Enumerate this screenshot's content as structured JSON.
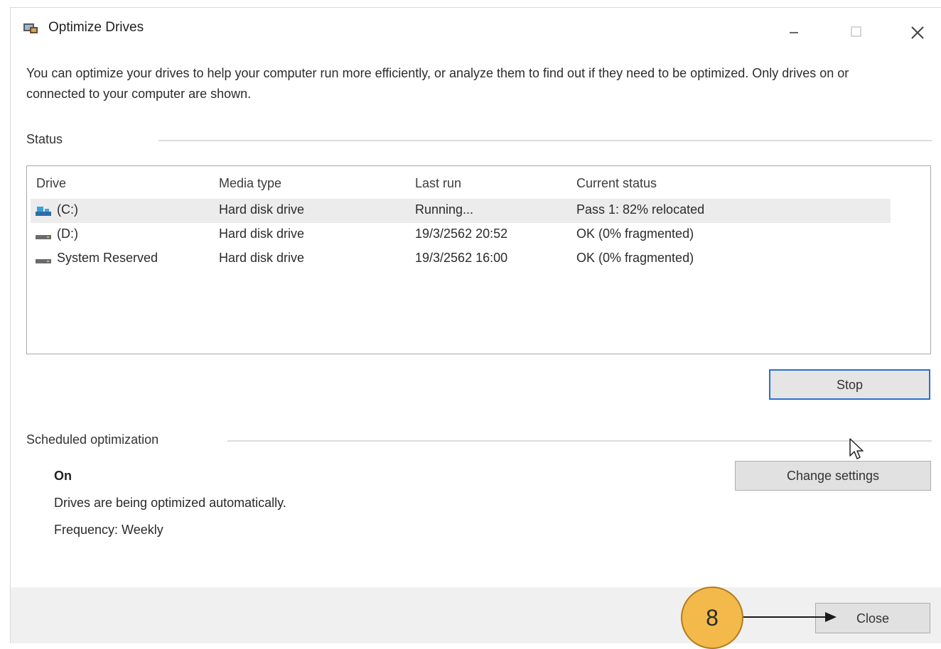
{
  "window": {
    "title": "Optimize Drives",
    "app_icon": "optimize-drives-icon",
    "controls": [
      "minimize-icon",
      "maximize-icon",
      "close-icon"
    ]
  },
  "description": "You can optimize your drives to help your computer run more efficiently, or analyze them to find out if they need to be optimized. Only drives on or connected to your computer are shown.",
  "status": {
    "label": "Status",
    "columns": [
      "Drive",
      "Media type",
      "Last run",
      "Current status"
    ],
    "rows": [
      {
        "drive": "(C:)",
        "icon": "system-drive-icon",
        "media_type": "Hard disk drive",
        "last_run": "Running...",
        "current_status": "Pass 1: 82% relocated",
        "selected": true
      },
      {
        "drive": "(D:)",
        "icon": "hard-drive-icon",
        "media_type": "Hard disk drive",
        "last_run": "19/3/2562 20:52",
        "current_status": "OK (0% fragmented)",
        "selected": false
      },
      {
        "drive": "System Reserved",
        "icon": "hard-drive-icon",
        "media_type": "Hard disk drive",
        "last_run": "19/3/2562 16:00",
        "current_status": "OK (0% fragmented)",
        "selected": false
      }
    ],
    "stop_button": "Stop"
  },
  "scheduled": {
    "label": "Scheduled optimization",
    "state": "On",
    "line1": "Drives are being optimized automatically.",
    "line2": "Frequency: Weekly",
    "change_button": "Change settings"
  },
  "footer": {
    "close_button": "Close"
  },
  "annotation": {
    "step_number": "8",
    "badge_color": "#f3b94b"
  },
  "colors": {
    "accent_border": "#2b6ed6",
    "selected_row": "#ececec",
    "footer_bg": "#f0f0f0"
  }
}
